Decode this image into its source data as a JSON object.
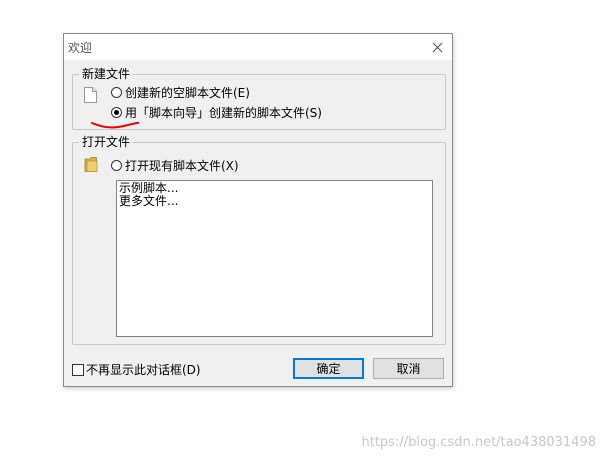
{
  "window": {
    "title": "欢迎",
    "close_icon": "close-icon"
  },
  "new_file_group": {
    "label": "新建文件",
    "icon": "blank-document-icon",
    "options": [
      {
        "label": "创建新的空脚本文件(E)",
        "selected": false
      },
      {
        "label": "用「脚本向导」创建新的脚本文件(S)",
        "selected": true
      }
    ],
    "annotation_color": "#e60000"
  },
  "open_file_group": {
    "label": "打开文件",
    "icon": "folder-icon",
    "option": {
      "label": "打开现有脚本文件(X)",
      "selected": false
    },
    "list_items": [
      "示例脚本...",
      "更多文件..."
    ]
  },
  "footer": {
    "dont_show_label": "不再显示此对话框(D)",
    "ok_label": "确定",
    "cancel_label": "取消"
  },
  "watermark": "https://blog.csdn.net/tao438031498",
  "colors": {
    "dialog_bg": "#f0f0f0",
    "default_button_border": "#0078d7"
  }
}
